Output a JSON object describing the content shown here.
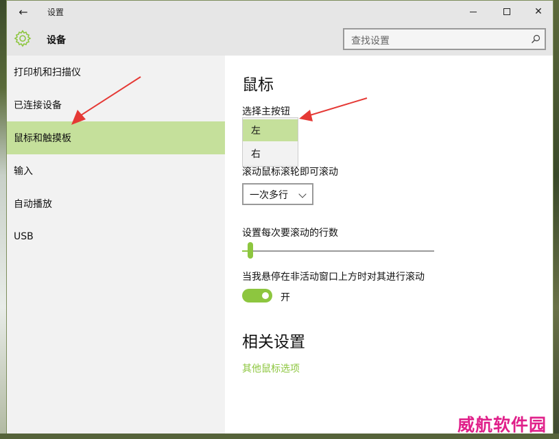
{
  "window": {
    "title": "设置",
    "back_icon": "back-arrow-icon",
    "min_icon": "minimize-icon",
    "max_icon": "maximize-icon",
    "close_icon": "close-icon",
    "close_glyph": "✕",
    "back_glyph": "←"
  },
  "header": {
    "title": "设备",
    "icon": "gear-icon",
    "accent": "#8dc63f"
  },
  "search": {
    "placeholder": "查找设置",
    "icon": "search-icon"
  },
  "sidebar": {
    "items": [
      {
        "label": "打印机和扫描仪",
        "selected": false
      },
      {
        "label": "已连接设备",
        "selected": false
      },
      {
        "label": "鼠标和触摸板",
        "selected": true
      },
      {
        "label": "输入",
        "selected": false
      },
      {
        "label": "自动播放",
        "selected": false
      },
      {
        "label": "USB",
        "selected": false
      }
    ],
    "selected_color": "#c5e09b"
  },
  "main": {
    "title": "鼠标",
    "primary_button": {
      "label": "选择主按钮",
      "options": [
        "左",
        "右"
      ],
      "selected": "左"
    },
    "scroll_wheel": {
      "label": "滚动鼠标滚轮即可滚动",
      "value": "一次多行"
    },
    "lines_to_scroll": {
      "label": "设置每次要滚动的行数",
      "value_fraction": 0.03
    },
    "inactive_scroll": {
      "label": "当我悬停在非活动窗口上方时对其进行滚动",
      "state": "开",
      "on": true
    },
    "related": {
      "title": "相关设置",
      "link": "其他鼠标选项"
    }
  },
  "watermark": "威航软件园",
  "colors": {
    "accent_green": "#8dc63f",
    "selection_green": "#c5e09b",
    "annotation_arrow": "#e53935",
    "watermark": "#e0208a"
  }
}
